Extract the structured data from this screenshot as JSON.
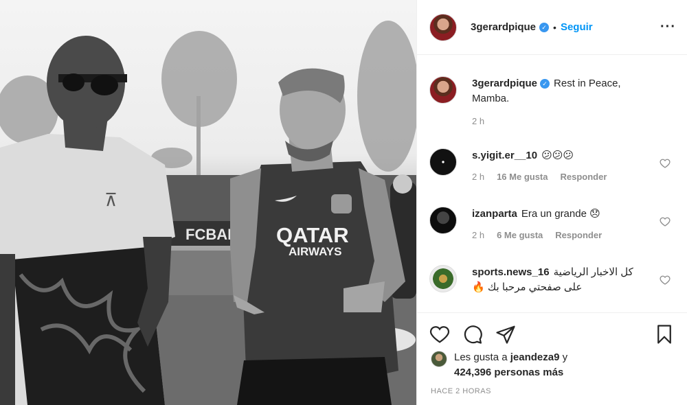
{
  "post": {
    "username": "3gerardpique",
    "follow_label": "Seguir",
    "dot": "•",
    "verified_icon": "verified-badge-icon",
    "more_icon": "more-options-icon"
  },
  "photo": {
    "jersey_sponsor_top": "QATAR",
    "jersey_sponsor_bottom": "AIRWAYS",
    "banner_text": "FCBAR",
    "kobe_logo": "kobe-logo-icon",
    "nike_logo": "nike-swoosh-icon"
  },
  "caption": {
    "username": "3gerardpique",
    "text": "Rest in Peace, Mamba.",
    "time": "2 h"
  },
  "comments": [
    {
      "username": "s.yigit.er__10",
      "text": "😕😕😕",
      "time": "2 h",
      "likes": "16 Me gusta",
      "reply": "Responder"
    },
    {
      "username": "izanparta",
      "text": "Era un grande 😞",
      "time": "2 h",
      "likes": "6 Me gusta",
      "reply": "Responder"
    },
    {
      "username": "sports.news_16",
      "text": "كل الاخبار الرياضية على صفحتي مرحبا بك 🔥"
    }
  ],
  "likes": {
    "prefix": "Les gusta a ",
    "first_user": "jeandeza9",
    "mid": " y",
    "count_text": "424,396 personas más"
  },
  "timestamp": "HACE 2 HORAS",
  "colors": {
    "accent": "#0095f6",
    "meta": "#8e8e8e",
    "verified": "#3897f0"
  }
}
